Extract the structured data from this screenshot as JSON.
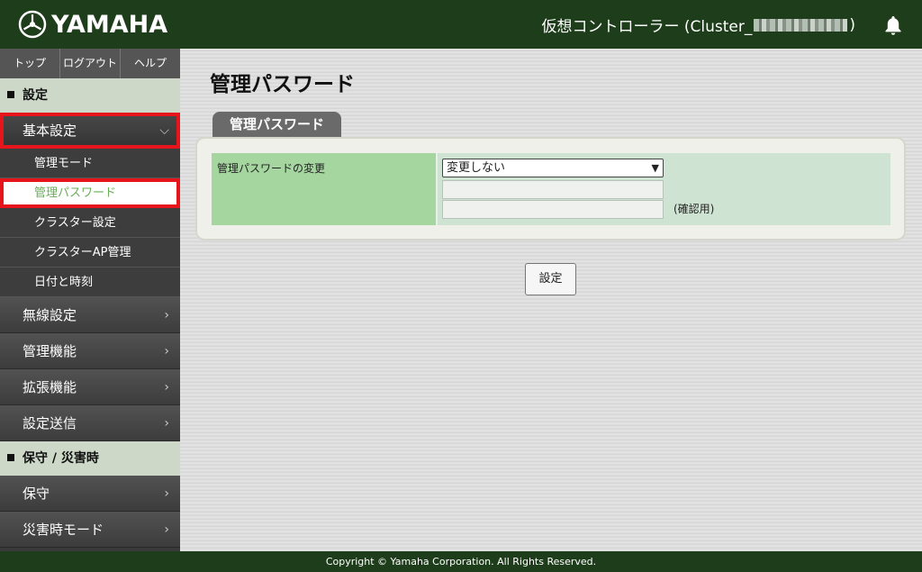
{
  "header": {
    "logo_text": "YAMAHA",
    "controller_label": "仮想コントローラー (Cluster_",
    "controller_suffix": ")"
  },
  "sidebar": {
    "topnav": [
      "トップ",
      "ログアウト",
      "ヘルプ"
    ],
    "section_settings": "設定",
    "basic_settings": "基本設定",
    "sub_items": [
      "管理モード",
      "管理パスワード",
      "クラスター設定",
      "クラスターAP管理",
      "日付と時刻"
    ],
    "menu_items": [
      "無線設定",
      "管理機能",
      "拡張機能",
      "設定送信"
    ],
    "section_maintenance": "保守 / 災害時",
    "maintenance_items": [
      "保守",
      "災害時モード"
    ]
  },
  "main": {
    "page_title": "管理パスワード",
    "tab_label": "管理パスワード",
    "row_label": "管理パスワードの変更",
    "select_value": "変更しない",
    "confirm_label": "(確認用)",
    "submit_label": "設定"
  },
  "footer": {
    "copyright": "Copyright © Yamaha Corporation. All Rights Reserved."
  }
}
